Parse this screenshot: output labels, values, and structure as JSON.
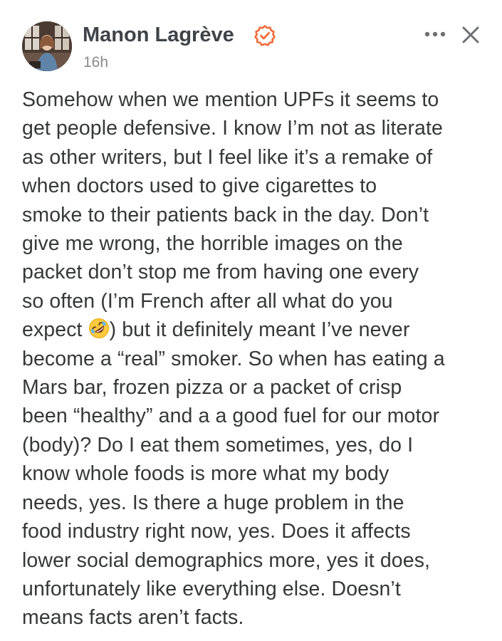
{
  "author": {
    "name": "Manon Lagrève",
    "avatar": "avatar-photo",
    "verified_icon": "verified-badge-icon",
    "verified_color": "#f26b3a",
    "timestamp": "16h"
  },
  "actions": {
    "more_icon": "more-dots-icon",
    "close_icon": "close-icon"
  },
  "comment": {
    "lines": [
      "Somehow when we mention UPFs it seems to",
      "get people defensive. I know I’m not as literate",
      "as other writers, but I feel like it’s a remake of",
      "when doctors used to give cigarettes to",
      "smoke to their patients back in the day. Don’t",
      "give me wrong, the horrible images on the",
      "packet don’t stop me from having one every",
      "so often (I’m French after all what do you",
      "expect",
      ") but it definitely meant I’ve never",
      "become a “real” smoker. So when has eating a",
      "Mars bar, frozen pizza or a packet of crisp",
      "been “healthy” and a a good fuel for our motor",
      "(body)? Do I eat them sometimes, yes, do I",
      "know whole foods is more what my body",
      "needs, yes. Is there a huge problem in the",
      "food industry right now, yes. Does it affects",
      "lower social demographics more, yes it does,",
      "unfortunately like everything else. Doesn’t",
      "means facts aren’t facts."
    ],
    "emoji_icon": "rolling-on-floor-laughing-emoji-icon"
  }
}
